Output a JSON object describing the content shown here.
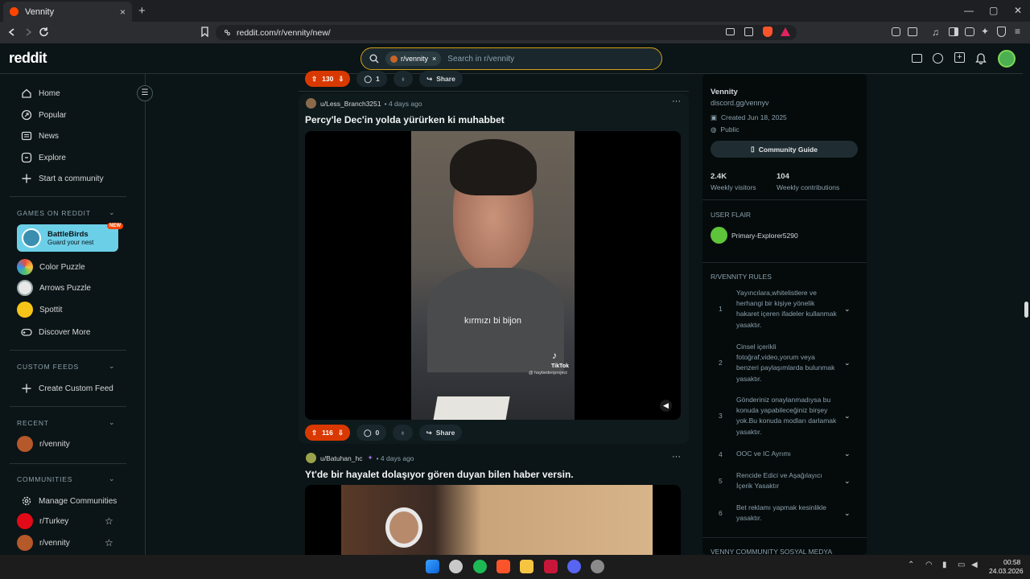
{
  "browser": {
    "tab_title": "Vennity",
    "tab_close": "×",
    "new_tab": "+",
    "url": "reddit.com/r/vennity/new/",
    "window_min": "—",
    "window_max": "▢",
    "window_close": "✕"
  },
  "header": {
    "logo": "reddit",
    "search_chip": "r/vennity",
    "search_chip_close": "×",
    "search_placeholder": "Search in r/vennity"
  },
  "sidebar": {
    "nav": [
      {
        "label": "Home",
        "icon": "home-icon"
      },
      {
        "label": "Popular",
        "icon": "popular-icon"
      },
      {
        "label": "News",
        "icon": "news-icon"
      },
      {
        "label": "Explore",
        "icon": "explore-icon"
      },
      {
        "label": "Start a community",
        "icon": "plus-icon"
      }
    ],
    "games_header": "GAMES ON REDDIT",
    "games": {
      "battlebirds": {
        "title": "BattleBirds",
        "subtitle": "Guard your nest",
        "badge": "NEW"
      },
      "color_puzzle": "Color Puzzle",
      "arrows_puzzle": "Arrows Puzzle",
      "spottit": "Spottit",
      "discover": "Discover More"
    },
    "custom_feeds_header": "CUSTOM FEEDS",
    "create_custom_feed": "Create Custom Feed",
    "recent_header": "RECENT",
    "recent_item": "r/vennity",
    "communities_header": "COMMUNITIES",
    "manage_communities": "Manage Communities",
    "communities": [
      "r/Turkey",
      "r/vennity"
    ]
  },
  "feed": {
    "top_bar": {
      "votes": "130",
      "comments": "1",
      "share": "Share"
    },
    "post1": {
      "author": "u/Less_Branch3251",
      "age": "• 4 days ago",
      "title": "Percy'le Dec'in yolda yürürken ki muhabbet",
      "subtitle_in_video": "kırmızı bi bijon",
      "tiktok_label": "TikTok",
      "tiktok_handle": "@ haybedenproject",
      "votes": "116",
      "comments": "0",
      "share": "Share"
    },
    "post2": {
      "author": "u/Batuhan_hc",
      "age": "• 4 days ago",
      "title": "Yt'de bir hayalet dolaşıyor gören duyan bilen haber versin."
    }
  },
  "right_sidebar": {
    "name": "Vennity",
    "link": "discord.gg/vennyv",
    "created": "Created Jun 18, 2025",
    "visibility": "Public",
    "guide_button": "Community Guide",
    "stats": [
      {
        "value": "2.4K",
        "label": "Weekly visitors"
      },
      {
        "value": "104",
        "label": "Weekly contributions"
      }
    ],
    "user_flair_header": "USER FLAIR",
    "user_flair": "Primary-Explorer5290",
    "rules_header": "R/VENNITY RULES",
    "rules": [
      {
        "num": "1",
        "text": "Yayıncılara,whitelistlere ve herhangi bir kişiye yönelik hakaret içeren ifadeler kullanmak yasaktır."
      },
      {
        "num": "2",
        "text": "Cinsel içerikli fotoğraf,video,yorum veya benzeri paylaşımlarda bulunmak yasaktır."
      },
      {
        "num": "3",
        "text": "Gönderiniz onaylanmadıysa bu konuda yapabileceğiniz birşey yok.Bu konuda modları darlamak yasaktır."
      },
      {
        "num": "4",
        "text": "OOC ve IC Ayrımı"
      },
      {
        "num": "5",
        "text": "Rencide Edici ve Aşağılayıcı İçerik Yasaktır"
      },
      {
        "num": "6",
        "text": "Bet reklamı yapmak kesinlikle yasaktır."
      }
    ],
    "social_header": "VENNY COMMUNITY SOSYAL MEDYA"
  },
  "taskbar": {
    "time": "00:58",
    "date": "24.03.2026"
  },
  "colors": {
    "upvote": "#d93900",
    "accent_search": "#d4a017",
    "bg": "#0b1416"
  }
}
